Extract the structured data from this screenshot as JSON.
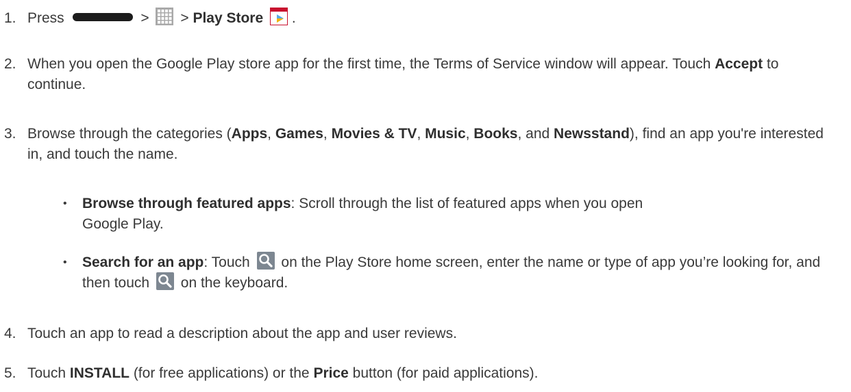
{
  "steps": [
    {
      "num": "1.",
      "press": "Press",
      "sep": ">",
      "play_store": "Play Store",
      "end": "."
    },
    {
      "num": "2.",
      "a": "When you open the Google Play store app for the first time, the Terms of Service window will appear. Touch ",
      "accept": "Accept",
      "b": " to continue."
    },
    {
      "num": "3.",
      "a": "Browse through the categories (",
      "apps": "Apps",
      "games": "Games",
      "movies": "Movies & TV",
      "music": "Music",
      "books": "Books",
      "newsstand": "Newsstand",
      "comma": ", ",
      "and": ", and ",
      "c": "), find an app you're interested in, and touch the name."
    },
    {
      "num": "4.",
      "a": "Touch an app to read a description about the app and user reviews."
    },
    {
      "num": "5.",
      "a": "Touch ",
      "install": "INSTALL",
      "b": " (for free applications) or the ",
      "price": "Price",
      "c": " button (for paid applications)."
    }
  ],
  "bullets": [
    {
      "dot": "•",
      "bold": "Browse through featured apps",
      "a": ": Scroll through the list of featured apps when you open Google Play."
    },
    {
      "dot": "•",
      "bold": "Search for an app",
      "a": ": Touch ",
      "b": " on the Play Store home screen, enter the name or type of app you’re looking for, and then touch ",
      "c": " on the keyboard."
    }
  ],
  "icons": {
    "home": "home-key-icon",
    "apps": "apps-grid-icon",
    "store": "play-store-icon",
    "search": "search-icon"
  },
  "colors": {
    "text": "#3a3a3a",
    "apps_icon": "#9a9a9a",
    "store_red": "#c8102e",
    "search_bg": "#7d8791"
  }
}
